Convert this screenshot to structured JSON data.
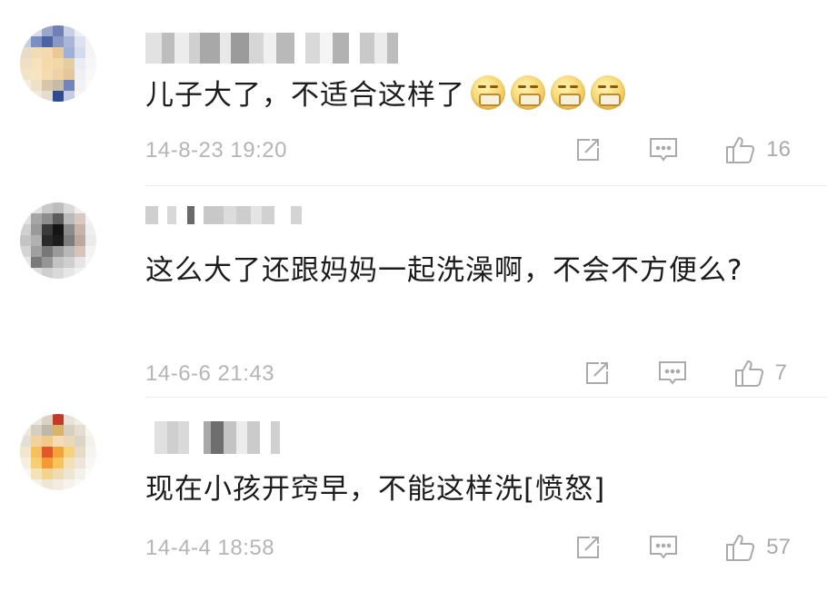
{
  "comments": [
    {
      "text": "儿子大了，不适合这样了",
      "emoji_count_label": "",
      "date": "14-8-23 19:20",
      "likes": "16"
    },
    {
      "text": "这么大了还跟妈妈一起洗澡啊，不会不方便么?",
      "date": "14-6-6 21:43",
      "likes": "7"
    },
    {
      "text": "现在小孩开窍早，不能这样洗[愤怒]",
      "date": "14-4-4 18:58",
      "likes": "57"
    }
  ],
  "icons": {
    "share": "share-icon",
    "reply": "comment-icon",
    "like": "thumbs-up-icon",
    "emoji": "sealed-mouth-emoji"
  },
  "colors": {
    "meta_text": "#b5b5b5",
    "icon": "#aaaaaa",
    "body_text": "#1c1c1c"
  }
}
